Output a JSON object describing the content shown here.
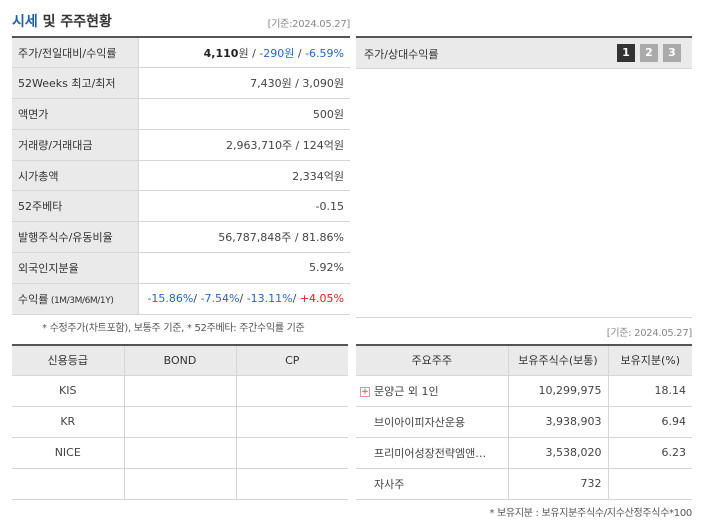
{
  "header": {
    "title_main": "시세",
    "title_rest": " 및 주주현황",
    "date_note": "[기준:2024.05.27]"
  },
  "price_table": {
    "rows": [
      {
        "label": "주가/전일대비/수익률",
        "price": "4,110",
        "unit": "원",
        "sep1": " / ",
        "change": "-290원",
        "sep2": " / ",
        "rate": "-6.59%"
      },
      {
        "label": "52Weeks 최고/최저",
        "value": "7,430원 / 3,090원"
      },
      {
        "label": "액면가",
        "value": "500원"
      },
      {
        "label": "거래량/거래대금",
        "value": "2,963,710주 / 124억원"
      },
      {
        "label": "시가총액",
        "value": "2,334억원"
      },
      {
        "label": "52주베타",
        "value": "-0.15"
      },
      {
        "label": "발행주식수/유동비율",
        "value": "56,787,848주 / 81.86%"
      },
      {
        "label": "외국인지분율",
        "value": "5.92%"
      },
      {
        "label": "수익률",
        "label_small": " (1M/3M/6M/1Y)",
        "r1": "-15.86%",
        "r2": "-7.54%",
        "r3": "-13.11%",
        "r4": "+4.05%",
        "sep": "/ "
      }
    ],
    "note": "* 수정주가(차트포함), 보통주 기준, * 52주베타: 주간수익률 기준"
  },
  "chart_panel": {
    "label": "주가/상대수익률",
    "pages": [
      "1",
      "2",
      "3"
    ],
    "active_page": "1"
  },
  "shareholder_date": "[기준: 2024.05.27]",
  "credit_table": {
    "headers": [
      "신용등급",
      "BOND",
      "CP"
    ],
    "rows": [
      [
        "KIS",
        "",
        ""
      ],
      [
        "KR",
        "",
        ""
      ],
      [
        "NICE",
        "",
        ""
      ],
      [
        "",
        "",
        ""
      ]
    ]
  },
  "holder_table": {
    "headers": [
      "주요주주",
      "보유주식수(보통)",
      "보유지분(%)"
    ],
    "rows": [
      {
        "name": "문양근 외 1인",
        "shares": "10,299,975",
        "pct": "18.14",
        "expand": "+"
      },
      {
        "name": "브이아이피자산운용",
        "shares": "3,938,903",
        "pct": "6.94"
      },
      {
        "name": "프리미어성장전략엠앤…",
        "shares": "3,538,020",
        "pct": "6.23"
      },
      {
        "name": "자사주",
        "shares": "732",
        "pct": ""
      }
    ],
    "note": "* 보유지분 : 보유지분주식수/지수산정주식수*100"
  },
  "colors": {
    "accent_blue": "#2266cc",
    "accent_red": "#dd2222",
    "title_blue": "#1d5fa8",
    "header_bg": "#eaeaea"
  }
}
